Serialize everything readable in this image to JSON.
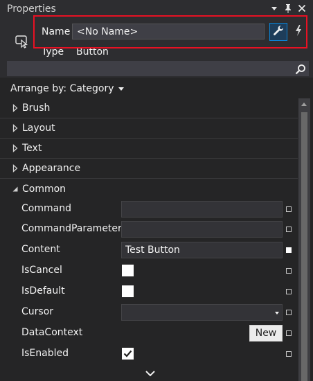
{
  "window": {
    "title": "Properties",
    "icons": [
      "dropdown-arrow-icon",
      "pin-icon",
      "close-icon"
    ]
  },
  "header": {
    "name_label": "Name",
    "name_value": "<No Name>",
    "type_label": "Type",
    "type_value": "Button",
    "buttons": [
      "properties-wrench-icon",
      "events-lightning-icon"
    ]
  },
  "search": {
    "placeholder": "",
    "icon": "search-icon"
  },
  "arrange": {
    "label": "Arrange by: Category"
  },
  "categories": {
    "brush": "Brush",
    "layout": "Layout",
    "text": "Text",
    "appearance": "Appearance",
    "common": "Common"
  },
  "common_props": {
    "command": {
      "name": "Command",
      "value": ""
    },
    "command_parameter": {
      "name": "CommandParameter",
      "value": ""
    },
    "content": {
      "name": "Content",
      "value": "Test Button"
    },
    "is_cancel": {
      "name": "IsCancel",
      "checked": false
    },
    "is_default": {
      "name": "IsDefault",
      "checked": false
    },
    "cursor": {
      "name": "Cursor",
      "value": ""
    },
    "data_context": {
      "name": "DataContext",
      "button": "New"
    },
    "is_enabled": {
      "name": "IsEnabled",
      "checked": true
    }
  },
  "colors": {
    "background": "#252526",
    "header": "#2d2d30",
    "accent": "#0a84d6",
    "highlight": "#e81123"
  }
}
